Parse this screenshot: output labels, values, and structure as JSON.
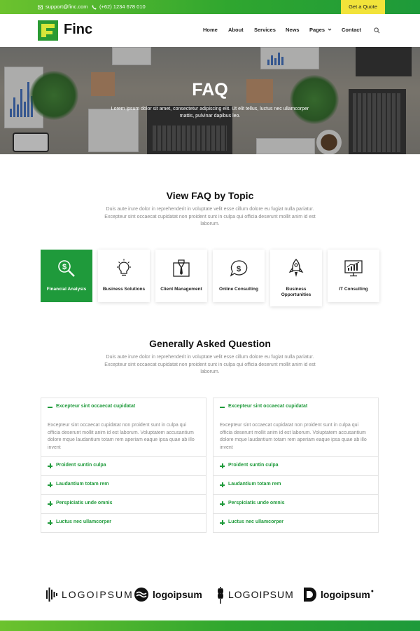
{
  "topbar": {
    "email": "support@finc.com",
    "phone": "(+62) 1234 678 010",
    "quote_button": "Get a Quote"
  },
  "brand": {
    "name": "Finc"
  },
  "nav": {
    "items": [
      "Home",
      "About",
      "Services",
      "News",
      "Pages",
      "Contact"
    ]
  },
  "hero": {
    "title": "FAQ",
    "subtitle": "Lorem ipsum dolor sit amet, consectetur adipiscing elit. Ut elit tellus, luctus nec ullamcorper mattis, pulvinar dapibus leo."
  },
  "topics": {
    "title": "View FAQ by Topic",
    "description": "Duis aute irure dolor in reprehenderit in voluptate velit esse cillum dolore eu fugiat nulla pariatur. Excepteur sint occaecat cupidatat non proident sunt in culpa qui officia deserunt mollit anim id est laborum.",
    "cards": [
      {
        "label": "Financial Analysis",
        "icon": "financial-analysis-icon",
        "active": true
      },
      {
        "label": "Business Solutions",
        "icon": "lightbulb-icon",
        "active": false
      },
      {
        "label": "Client Management",
        "icon": "client-management-icon",
        "active": false
      },
      {
        "label": "Online Consulting",
        "icon": "online-consulting-icon",
        "active": false
      },
      {
        "label": "Business Opportunities",
        "icon": "rocket-icon",
        "active": false
      },
      {
        "label": "IT Consulting",
        "icon": "monitor-chart-icon",
        "active": false
      }
    ]
  },
  "faq": {
    "title": "Generally Asked Question",
    "description": "Duis aute irure dolor in reprehenderit in voluptate velit esse cillum dolore eu fugiat nulla pariatur. Excepteur sint occaecat cupidatat non proident sunt in culpa qui officia deserunt mollit anim id est laborum.",
    "left": {
      "open_question": "Excepteur sint occaecat cupidatat",
      "open_answer": "Excepteur sint occaecat cupidatat non proident sunt in culpa qui officia deserunt mollit anim id est laborum. Voluptatem accusantium dolore mque laudantium totam rem aperiam eaque ipsa quae ab illo invent",
      "questions": [
        "Proident suntin culpa",
        "Laudantium totam rem",
        "Perspiciatis unde omnis",
        "Luctus nec ullamcorper"
      ]
    },
    "right": {
      "open_question": "Excepteur sint occaecat cupidatat",
      "open_answer": "Excepteur sint occaecat cupidatat non proident sunt in culpa qui officia deserunt mollit anim id est laborum. Voluptatem accusantium dolore mque laudantium totam rem aperiam eaque ipsa quae ab illo invent",
      "questions": [
        "Proident suntin culpa",
        "Laudantium totam rem",
        "Perspiciatis unde omnis",
        "Luctus nec ullamcorper"
      ]
    }
  },
  "partners": {
    "logos": [
      "LOGOIPSUM",
      "logoipsum",
      "LOGOIPSUM",
      "logoipsum"
    ]
  },
  "colors": {
    "primary_green": "#1f9a3b",
    "accent_yellow": "#f2e33a",
    "logo_lime": "#d7e53a"
  }
}
